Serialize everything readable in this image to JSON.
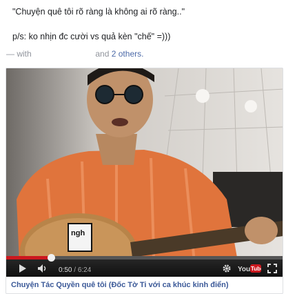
{
  "post": {
    "line1": "\"Chuyện quê tôi rõ ràng là không ai rõ ràng..\"",
    "line2": "p/s: ko nhịn đc cười vs quả kèn \"chế\" =)))",
    "with_prefix": "— with",
    "with_and": "and",
    "with_others": "2 others."
  },
  "video": {
    "progress_fraction": 0.161,
    "current_time": "0:50",
    "separator": "/",
    "duration": "6:24",
    "logo_text": "You Tube",
    "sticker_text": "ngh",
    "caption": "Chuyện Tác Quyền quê tôi (Đốc Tờ Ti với ca khúc kinh điển)"
  },
  "icons": {
    "play": "play-icon",
    "volume": "volume-icon",
    "settings": "gear-icon",
    "fullscreen": "fullscreen-icon"
  }
}
